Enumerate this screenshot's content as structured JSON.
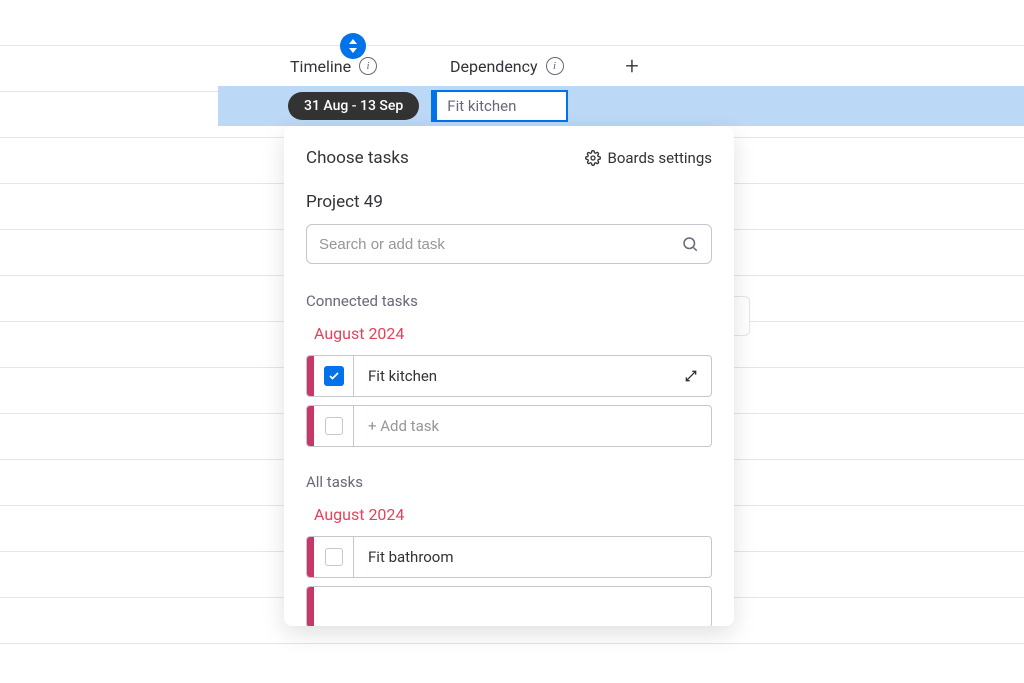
{
  "columns": {
    "timeline": "Timeline",
    "dependency": "Dependency"
  },
  "timeline_bar": {
    "date_range": "31 Aug - 13 Sep",
    "active_task": "Fit kitchen"
  },
  "dropdown": {
    "title": "Choose tasks",
    "boards_settings": "Boards settings",
    "project": "Project 49",
    "search_placeholder": "Search or add task",
    "connected": {
      "label": "Connected tasks",
      "month": "August 2024",
      "tasks": [
        {
          "label": "Fit kitchen",
          "checked": true
        },
        {
          "label": "+ Add task",
          "checked": false,
          "muted": true
        }
      ]
    },
    "all": {
      "label": "All tasks",
      "month": "August 2024",
      "tasks": [
        {
          "label": "Fit bathroom",
          "checked": false
        }
      ]
    }
  }
}
